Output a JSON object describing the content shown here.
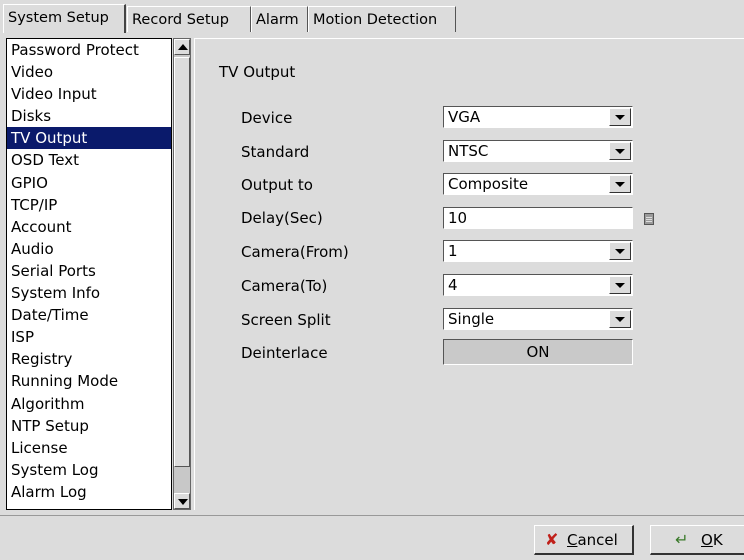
{
  "tabs": [
    {
      "label": "System Setup",
      "active": true
    },
    {
      "label": "Record Setup",
      "active": false
    },
    {
      "label": "Alarm",
      "active": false
    },
    {
      "label": "Motion Detection",
      "active": false
    }
  ],
  "sidebar": {
    "items": [
      "Password Protect",
      "Video",
      "Video Input",
      "Disks",
      "TV Output",
      "OSD Text",
      "GPIO",
      "TCP/IP",
      "Account",
      "Audio",
      "Serial Ports",
      "System Info",
      "Date/Time",
      "ISP",
      "Registry",
      "Running Mode",
      "Algorithm",
      "NTP Setup",
      "License",
      "System Log",
      "Alarm Log"
    ],
    "selected": "TV Output"
  },
  "panel": {
    "title": "TV Output",
    "device": {
      "label": "Device",
      "value": "VGA"
    },
    "standard": {
      "label": "Standard",
      "value": "NTSC"
    },
    "output_to": {
      "label": "Output to",
      "value": "Composite"
    },
    "delay": {
      "label": "Delay(Sec)",
      "value": "10"
    },
    "camera_from": {
      "label": "Camera(From)",
      "value": "1"
    },
    "camera_to": {
      "label": "Camera(To)",
      "value": "4"
    },
    "screen_split": {
      "label": "Screen Split",
      "value": "Single"
    },
    "deinterlace": {
      "label": "Deinterlace",
      "value": "ON"
    }
  },
  "buttons": {
    "cancel": {
      "label_first": "C",
      "label_rest": "ancel",
      "icon": "cancel-x-icon"
    },
    "ok": {
      "label_first": "O",
      "label_rest": "K",
      "icon": "ok-check-icon"
    }
  },
  "colors": {
    "selection": "#0a1a6b",
    "cancel_icon": "#c0201a",
    "ok_icon": "#3a7a2a"
  }
}
